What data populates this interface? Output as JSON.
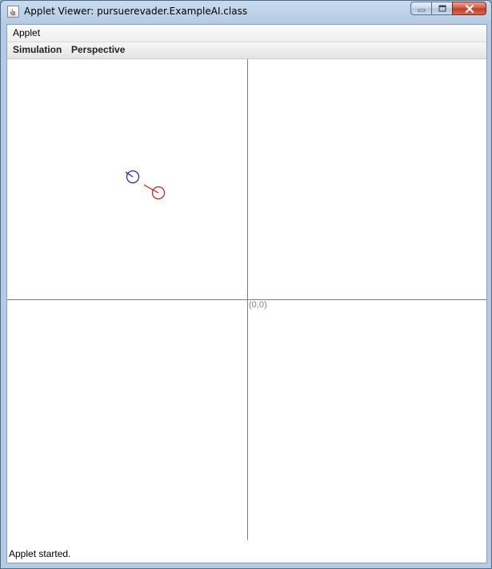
{
  "window": {
    "title": "Applet Viewer: pursuerevader.ExampleAI.class"
  },
  "menubar": {
    "applet_label": "Applet"
  },
  "sim_menubar": {
    "simulation_label": "Simulation",
    "perspective_label": "Perspective"
  },
  "canvas": {
    "origin_label": "(0,0)",
    "colors": {
      "evader": "#1c1cc8",
      "pursuer": "#d01a1a",
      "axes": "#7d7d7d"
    }
  },
  "status": {
    "text": "Applet started."
  }
}
